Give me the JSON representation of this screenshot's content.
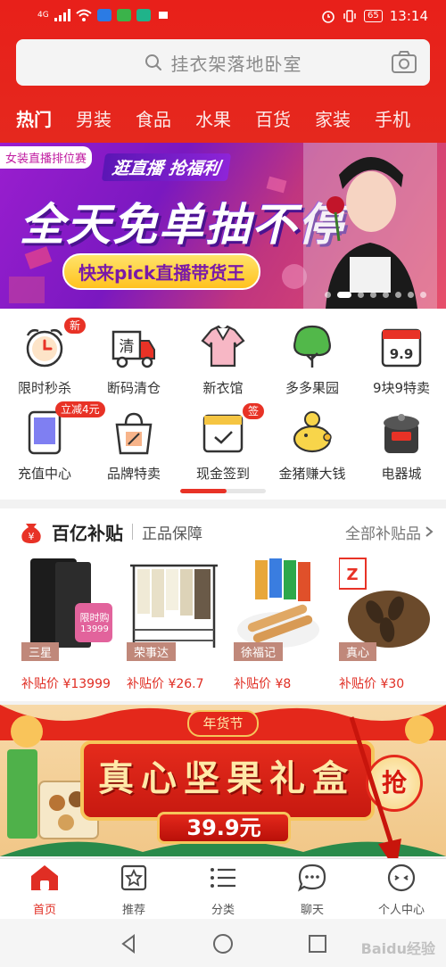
{
  "status_bar": {
    "network": "4G",
    "battery": "65",
    "time": "13:14"
  },
  "search": {
    "placeholder": "挂衣架落地卧室"
  },
  "categories": [
    "热门",
    "男装",
    "食品",
    "水果",
    "百货",
    "家装",
    "手机"
  ],
  "banner": {
    "tag": "女装直播排位赛",
    "kicker": "逛直播 抢福利",
    "headline": "全天免单抽不停",
    "cta": "快来pick直播带货王"
  },
  "shortcuts": [
    {
      "label": "限时秒杀",
      "icon": "alarm-clock-icon",
      "badge": "新"
    },
    {
      "label": "断码清仓",
      "icon": "truck-clearance-icon",
      "badge": ""
    },
    {
      "label": "新衣馆",
      "icon": "clothes-icon",
      "badge": ""
    },
    {
      "label": "多多果园",
      "icon": "tree-icon",
      "badge": ""
    },
    {
      "label": "9块9特卖",
      "icon": "calendar-99-icon",
      "badge": ""
    },
    {
      "label": "充值中心",
      "icon": "tablet-icon",
      "badge": "立减4元"
    },
    {
      "label": "品牌特卖",
      "icon": "shopping-bag-icon",
      "badge": ""
    },
    {
      "label": "现金签到",
      "icon": "calendar-check-icon",
      "badge": "签"
    },
    {
      "label": "金猪赚大钱",
      "icon": "piggy-bank-icon",
      "badge": ""
    },
    {
      "label": "电器城",
      "icon": "pressure-cooker-icon",
      "badge": ""
    }
  ],
  "shortcut_page_labels": {
    "clean": "清",
    "nine": "9.9"
  },
  "subsidy": {
    "title": "百亿补贴",
    "subtitle": "正品保障",
    "more": "全部补贴品",
    "products": [
      {
        "brand": "三星",
        "price": "补贴价 ¥13999",
        "promo_badge": "限时购",
        "promo_price": "13999"
      },
      {
        "brand": "荣事达",
        "price": "补贴价 ¥26.7"
      },
      {
        "brand": "徐福记",
        "price": "补贴价 ¥8"
      },
      {
        "brand": "真心",
        "price": "补贴价 ¥30"
      }
    ]
  },
  "promo": {
    "tag": "年货节",
    "title": "真心坚果礼盒",
    "price": "39.9元",
    "grab": "抢"
  },
  "tabbar": [
    {
      "label": "首页",
      "icon": "home-icon",
      "active": true
    },
    {
      "label": "推荐",
      "icon": "star-icon",
      "active": false
    },
    {
      "label": "分类",
      "icon": "list-icon",
      "active": false
    },
    {
      "label": "聊天",
      "icon": "chat-icon",
      "active": false
    },
    {
      "label": "个人中心",
      "icon": "profile-icon",
      "active": false
    }
  ],
  "watermark": "Baidu经验",
  "colors": {
    "brand_red": "#e02e24",
    "header_red": "#e8201a",
    "banner_purple": "#9a1ecf"
  }
}
